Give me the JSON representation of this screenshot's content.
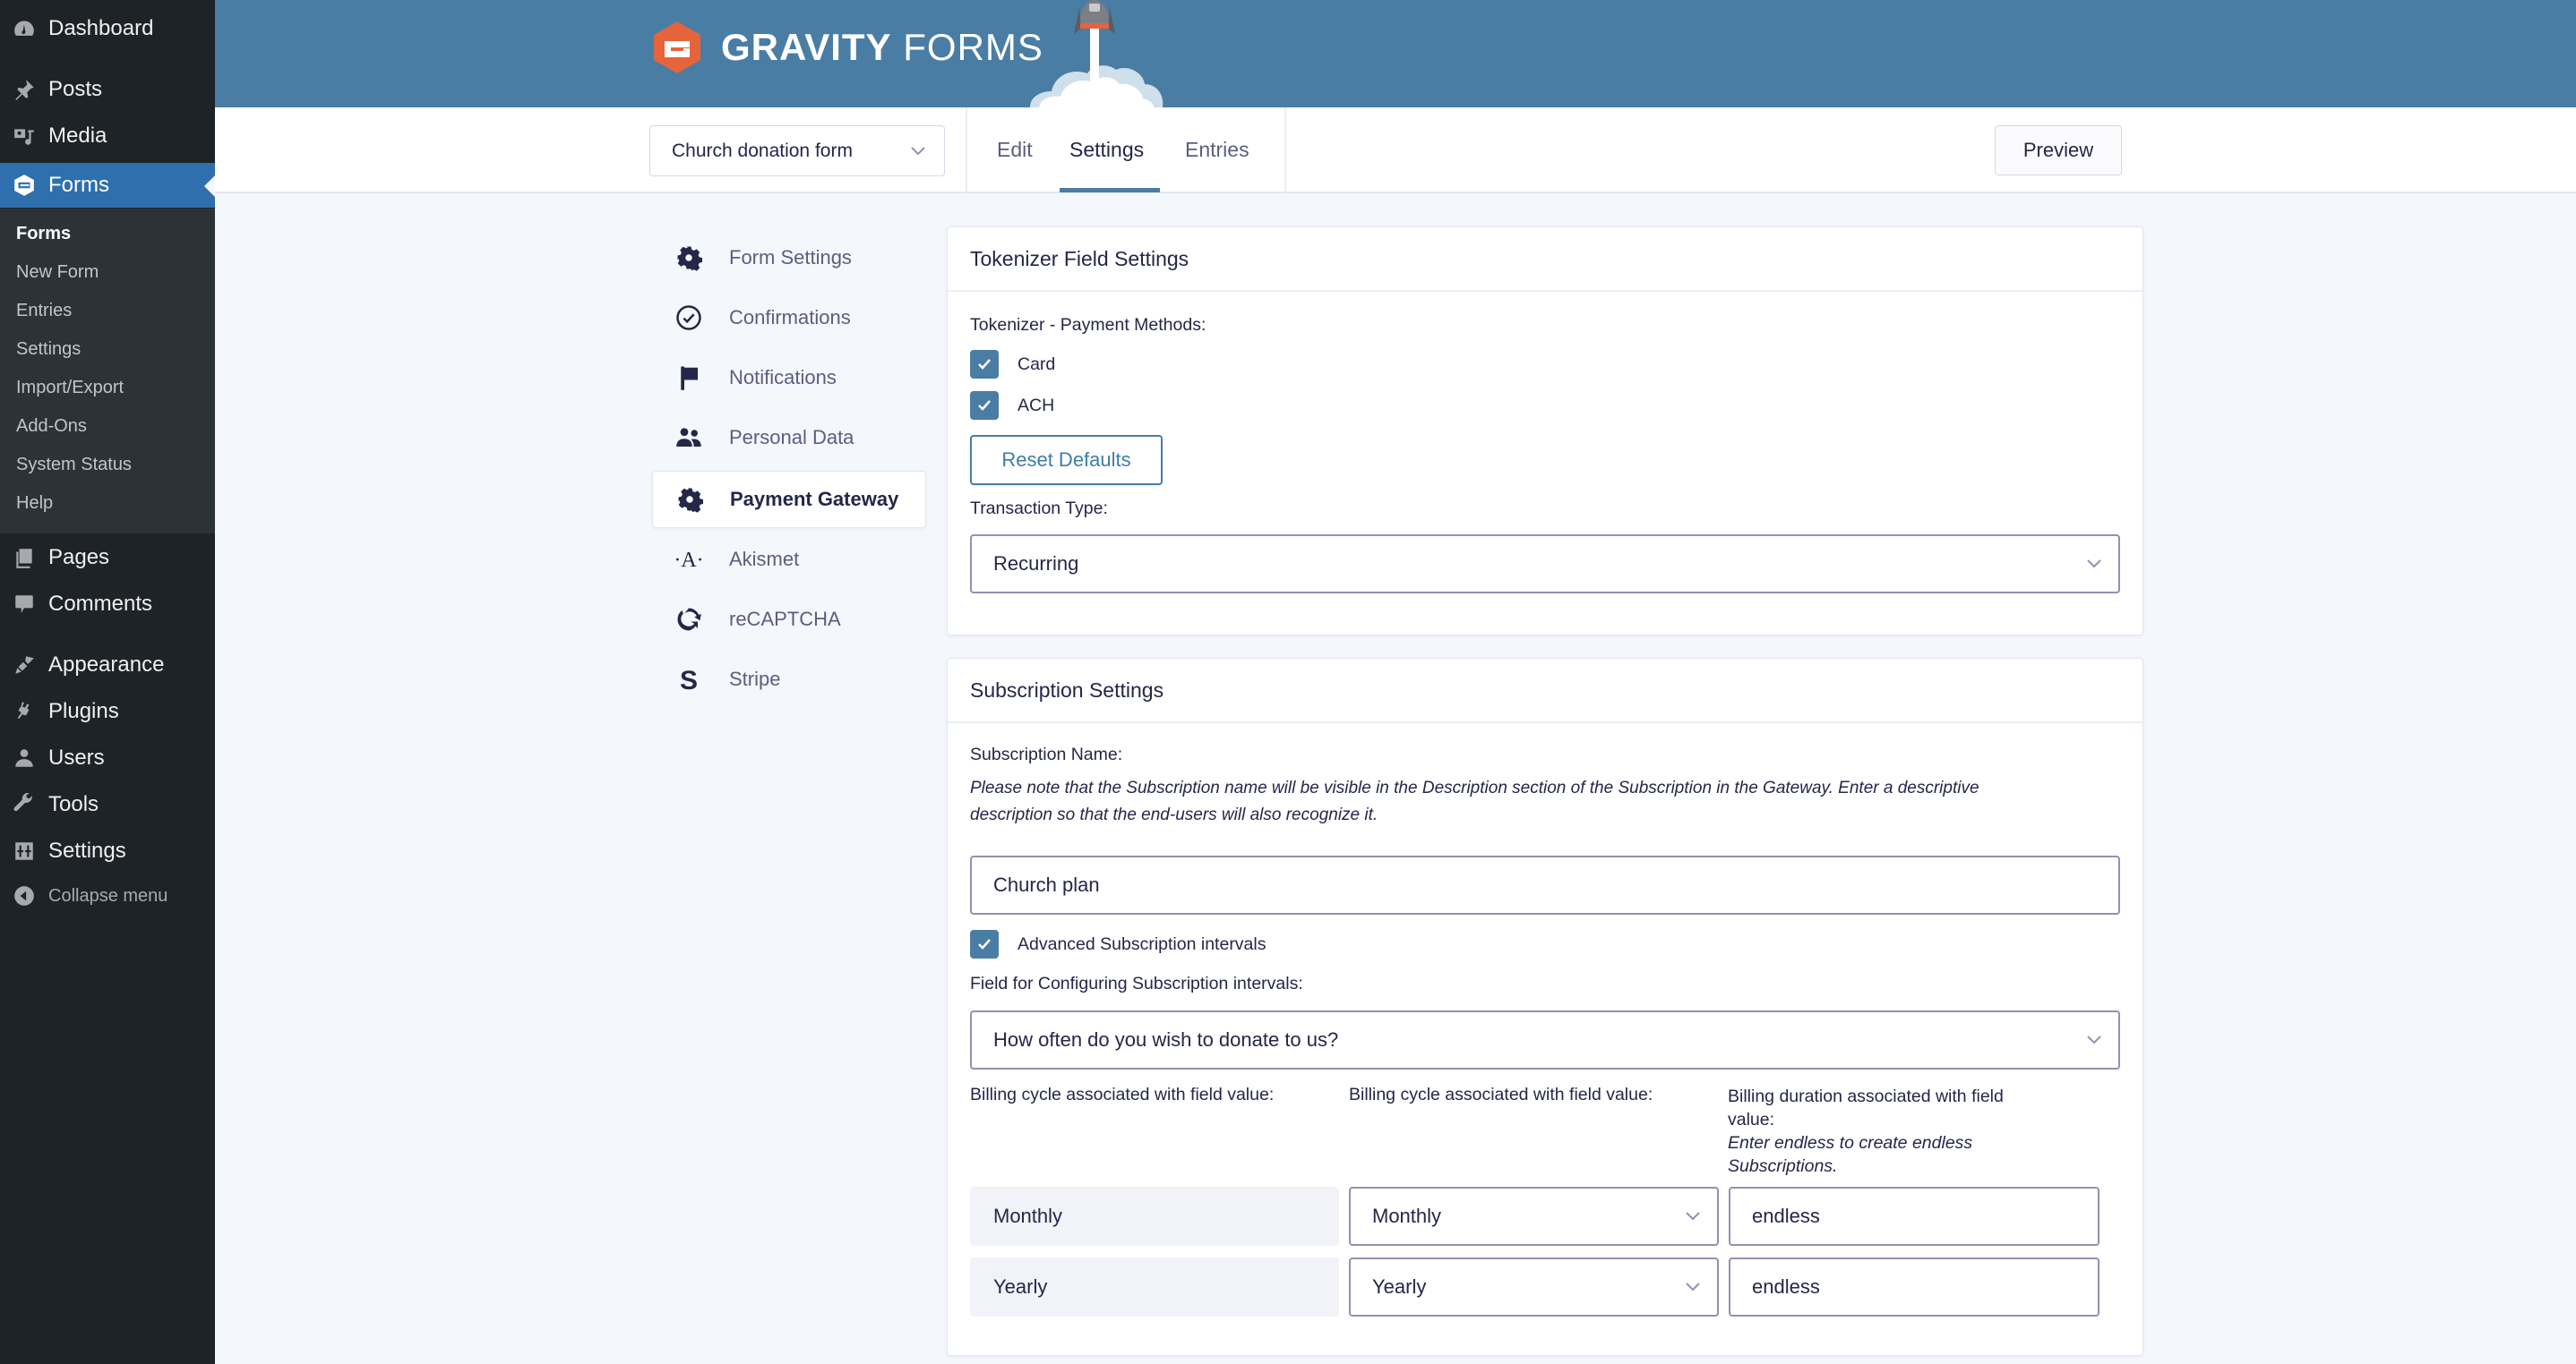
{
  "wp_menu": {
    "items": [
      {
        "label": "Dashboard",
        "icon": "dashboard-icon"
      },
      {
        "label": "Posts",
        "icon": "pin-icon"
      },
      {
        "label": "Media",
        "icon": "media-icon"
      },
      {
        "label": "Forms",
        "icon": "gravity-forms-icon",
        "active": true
      },
      {
        "label": "Pages",
        "icon": "pages-icon"
      },
      {
        "label": "Comments",
        "icon": "comment-icon"
      },
      {
        "label": "Appearance",
        "icon": "brush-icon"
      },
      {
        "label": "Plugins",
        "icon": "plug-icon"
      },
      {
        "label": "Users",
        "icon": "user-icon"
      },
      {
        "label": "Tools",
        "icon": "wrench-icon"
      },
      {
        "label": "Settings",
        "icon": "settings-sliders-icon"
      }
    ],
    "forms_submenu": [
      "Forms",
      "New Form",
      "Entries",
      "Settings",
      "Import/Export",
      "Add-Ons",
      "System Status",
      "Help"
    ],
    "collapse_label": "Collapse menu"
  },
  "header": {
    "brand_bold": "GRAVITY",
    "brand_light": "FORMS",
    "colors": {
      "header_bg": "#4a7da4",
      "logo_orange": "#e6643c"
    }
  },
  "toolbar": {
    "form_selector": "Church donation form",
    "tabs": [
      "Edit",
      "Settings",
      "Entries"
    ],
    "active_tab": "Settings",
    "preview_label": "Preview"
  },
  "settings_nav": {
    "items": [
      {
        "label": "Form Settings",
        "icon": "gear-icon"
      },
      {
        "label": "Confirmations",
        "icon": "check-circle-icon"
      },
      {
        "label": "Notifications",
        "icon": "flag-icon"
      },
      {
        "label": "Personal Data",
        "icon": "people-icon"
      },
      {
        "label": "Payment Gateway",
        "icon": "gear-icon",
        "active": true
      },
      {
        "label": "Akismet",
        "icon": "akismet-icon"
      },
      {
        "label": "reCAPTCHA",
        "icon": "recaptcha-icon"
      },
      {
        "label": "Stripe",
        "icon": "stripe-icon"
      }
    ]
  },
  "tokenizer": {
    "title": "Tokenizer Field Settings",
    "payment_methods_label": "Tokenizer - Payment Methods:",
    "methods": [
      {
        "label": "Card",
        "checked": true
      },
      {
        "label": "ACH",
        "checked": true
      }
    ],
    "reset_label": "Reset Defaults",
    "transaction_type_label": "Transaction Type:",
    "transaction_type_value": "Recurring"
  },
  "subscription": {
    "title": "Subscription Settings",
    "name_label": "Subscription Name:",
    "name_note_line1": "Please note that the Subscription name will be visible in the Description section of the Subscription in the Gateway. Enter a descriptive",
    "name_note_line2": "description so that the end-users will also recognize it.",
    "name_value": "Church plan",
    "advanced_label": "Advanced Subscription intervals",
    "advanced_checked": true,
    "field_label": "Field for Configuring Subscription intervals:",
    "field_value": "How often do you wish to donate to us?",
    "col1_header": "Billing cycle associated with field value:",
    "col2_header": "Billing cycle associated with field value:",
    "col3_header_line1": "Billing duration associated with field",
    "col3_header_line2": "value:",
    "col3_note_line1": "Enter endless to create endless",
    "col3_note_line2": "Subscriptions.",
    "rows": [
      {
        "field_value": "Monthly",
        "billing_cycle": "Monthly",
        "duration": "endless"
      },
      {
        "field_value": "Yearly",
        "billing_cycle": "Yearly",
        "duration": "endless"
      }
    ]
  }
}
